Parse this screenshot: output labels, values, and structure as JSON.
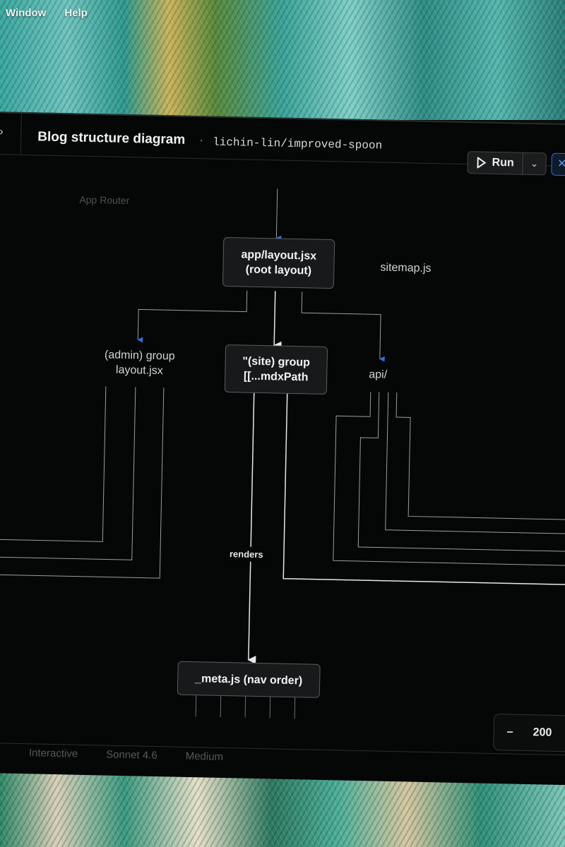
{
  "os_menu": {
    "window": "Window",
    "help": "Help"
  },
  "header": {
    "title": "Blog structure diagram",
    "separator": "·",
    "repo": "lichin-lin/improved-spoon",
    "run_label": "Run"
  },
  "diagram": {
    "group_label": "App Router",
    "nodes": {
      "root": [
        "app/layout.jsx",
        "(root layout)"
      ],
      "sitemap": "sitemap.js",
      "admin": [
        "(admin) group",
        "layout.jsx"
      ],
      "site": [
        "\"(site) group",
        "[[...mdxPath"
      ],
      "api": "api/",
      "meta": "_meta.js (nav order)"
    },
    "edge_label": "renders"
  },
  "zoom": {
    "minus": "–",
    "value": "200"
  },
  "composer": {
    "mode": "Interactive",
    "model": "Sonnet 4.6",
    "effort": "Medium"
  },
  "colors": {
    "arrow": "#2f6fd6",
    "line": "#cfd3d6",
    "node_bg": "#17191a"
  }
}
